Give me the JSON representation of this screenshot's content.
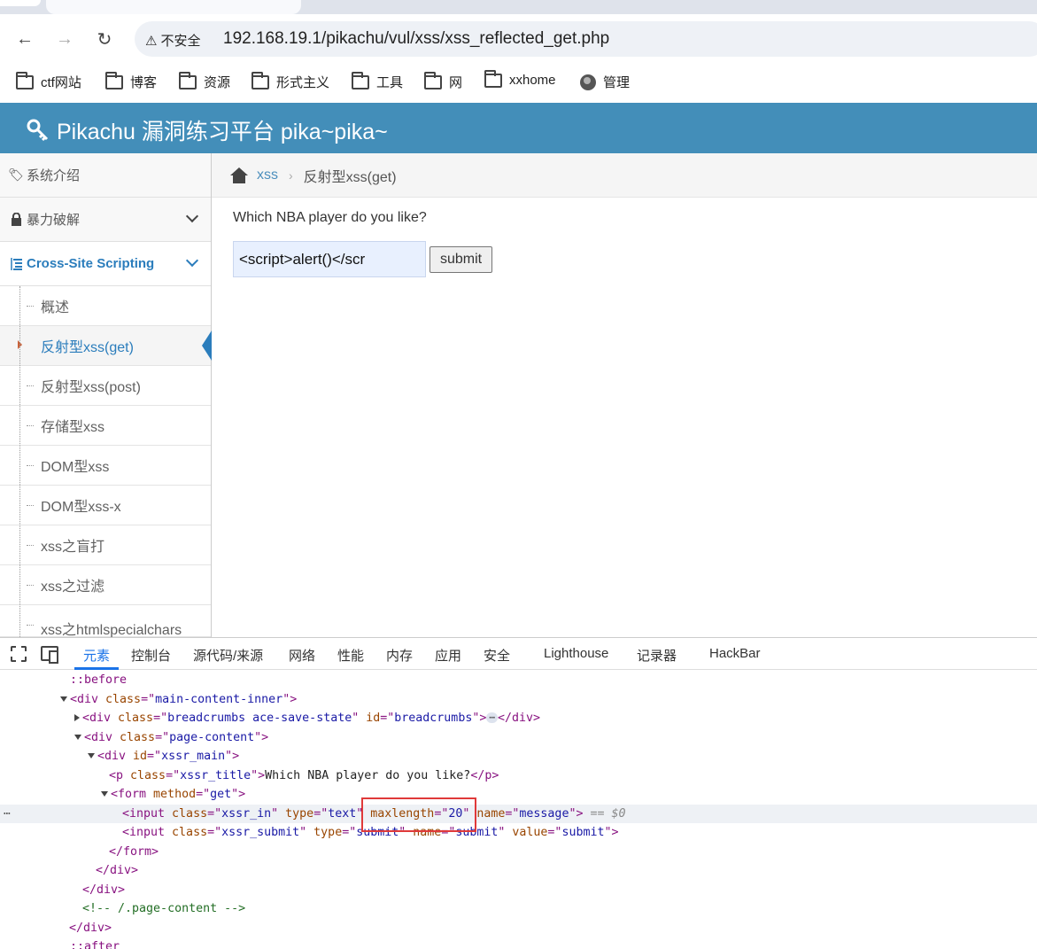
{
  "browser": {
    "security_label": "不安全",
    "url": "192.168.19.1/pikachu/vul/xss/xss_reflected_get.php",
    "bookmarks": [
      {
        "label": "ctf网站",
        "icon": "folder-icon"
      },
      {
        "label": "博客",
        "icon": "folder-icon"
      },
      {
        "label": "资源",
        "icon": "folder-icon"
      },
      {
        "label": "形式主义",
        "icon": "folder-icon"
      },
      {
        "label": "工具",
        "icon": "folder-icon"
      },
      {
        "label": "网",
        "icon": "folder-icon"
      },
      {
        "label": "xxhome",
        "icon": "folder-icon"
      },
      {
        "label": "管理",
        "icon": "globe-icon"
      }
    ]
  },
  "app": {
    "title": "Pikachu 漏洞练习平台 pika~pika~"
  },
  "sidebar": {
    "top_items": [
      {
        "label": "系统介绍",
        "icon": "tags-icon"
      },
      {
        "label": "暴力破解",
        "icon": "lock-icon"
      },
      {
        "label": "Cross-Site Scripting",
        "icon": "list-icon"
      }
    ],
    "sub_items": [
      "概述",
      "反射型xss(get)",
      "反射型xss(post)",
      "存储型xss",
      "DOM型xss",
      "DOM型xss-x",
      "xss之盲打",
      "xss之过滤",
      "xss之htmlspecialchars"
    ]
  },
  "breadcrumbs": {
    "parent": "xss",
    "current": "反射型xss(get)"
  },
  "form": {
    "question": "Which NBA player do you like?",
    "input_value": "<script>alert()</scr",
    "submit_label": "submit"
  },
  "devtools": {
    "tabs": [
      "元素",
      "控制台",
      "源代码/来源",
      "网络",
      "性能",
      "内存",
      "应用",
      "安全",
      "Lighthouse",
      "记录器",
      "HackBar"
    ],
    "active_tab": "元素",
    "dom": {
      "before": "::before",
      "after": "::after",
      "main_content_inner": "main-content-inner",
      "breadcrumbs_class": "breadcrumbs ace-save-state",
      "breadcrumbs_id": "breadcrumbs",
      "page_content": "page-content",
      "xssr_main": "xssr_main",
      "xssr_title": "xssr_title",
      "title_text": "Which NBA player do you like?",
      "form_method": "get",
      "input_class": "xssr_in",
      "input_type": "text",
      "input_maxlength": "20",
      "input_name": "message",
      "submit_class": "xssr_submit",
      "submit_type": "submit",
      "submit_name": "submit",
      "submit_value": "submit",
      "comment": "<!-- /.page-content -->",
      "selected_marker": "== $0"
    }
  },
  "colors": {
    "header_bg": "#438eb9",
    "link": "#2b7dbc",
    "highlight_box": "#e03a3a"
  }
}
